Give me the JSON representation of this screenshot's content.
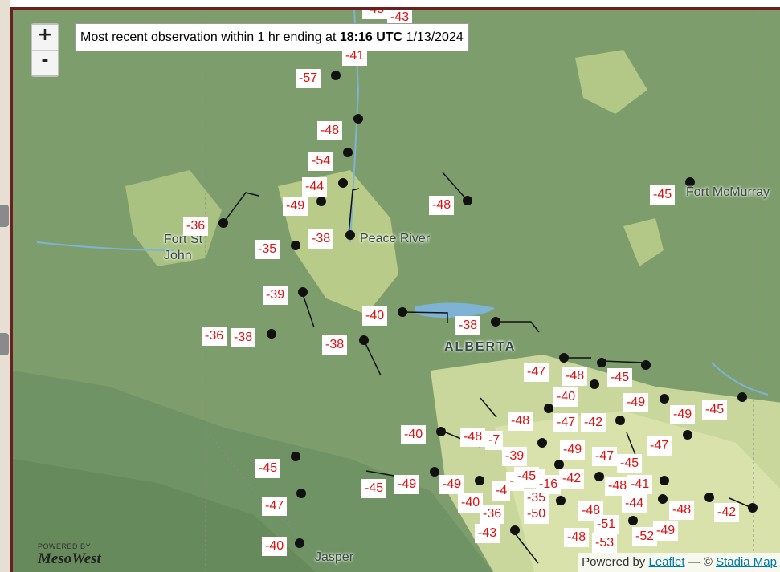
{
  "map": {
    "zoom_in_label": "+",
    "zoom_out_label": "-",
    "obs_prefix": "Most recent observation within 1 hr ending at",
    "obs_time": "18:16 UTC",
    "obs_date": "1/13/2024",
    "attribution_prefix": "Powered by",
    "attribution_leaflet": "Leaflet",
    "attribution_sep": "— ©",
    "attribution_stadia": "Stadia Map",
    "brand_small": "POWERED BY",
    "brand_name": "MesoWest"
  },
  "places": [
    "Fort McMurray",
    "Peace River",
    "Fort St John",
    "ALBERTA",
    "Jasper"
  ],
  "temps": [
    "-45",
    "-43",
    "-41",
    "-57",
    "-48",
    "-54",
    "-44",
    "-49",
    "-36",
    "-38",
    "-35",
    "-48",
    "-45",
    "-39",
    "-36",
    "-38",
    "-38",
    "-40",
    "-38",
    "-47",
    "-48",
    "-45",
    "-40",
    "-49",
    "-48",
    "-47",
    "-42",
    "-49",
    "-45",
    "-40",
    "-48",
    "-7",
    "-49",
    "-47",
    "-39",
    "-47",
    "-45",
    "-45",
    "-45",
    "-49",
    "-49",
    "-4",
    "-45",
    "-16",
    "-42",
    "-4",
    "-48",
    "-41",
    "-40",
    "-36",
    "-35",
    "-50",
    "-48",
    "-44",
    "-48",
    "-42",
    "-43",
    "-51",
    "-48",
    "-53",
    "-52",
    "-49",
    "-40",
    "-47",
    "-45"
  ]
}
